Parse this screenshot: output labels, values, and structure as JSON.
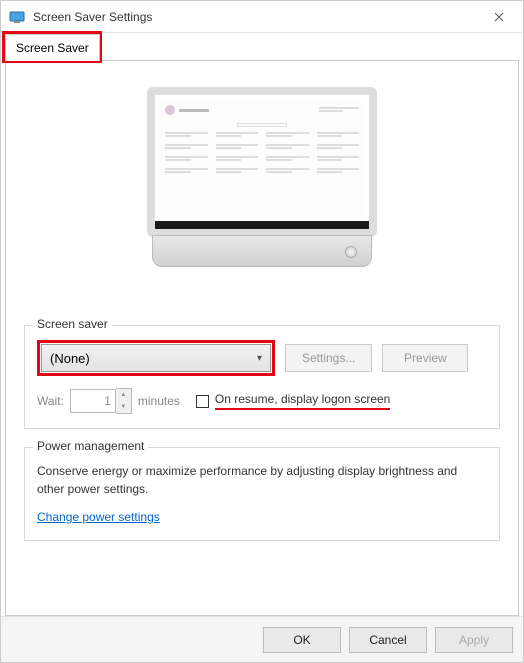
{
  "titlebar": {
    "title": "Screen Saver Settings"
  },
  "tab": {
    "label": "Screen Saver"
  },
  "saver": {
    "legend": "Screen saver",
    "selected": "(None)",
    "settings_btn": "Settings...",
    "preview_btn": "Preview",
    "wait_label": "Wait:",
    "wait_value": "1",
    "minutes_label": "minutes",
    "resume_label": "On resume, display logon screen"
  },
  "power": {
    "legend": "Power management",
    "text": "Conserve energy or maximize performance by adjusting display brightness and other power settings.",
    "link": "Change power settings"
  },
  "buttons": {
    "ok": "OK",
    "cancel": "Cancel",
    "apply": "Apply"
  }
}
